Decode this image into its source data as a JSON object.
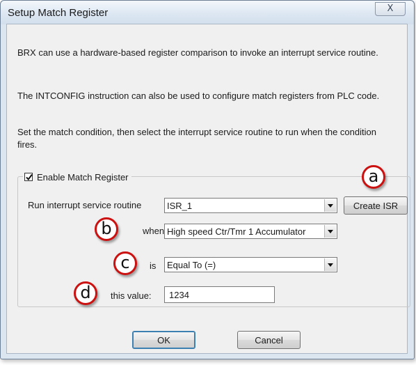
{
  "window": {
    "title": "Setup Match Register",
    "close_glyph": "X"
  },
  "description": {
    "p1": "BRX can use a hardware-based register comparison to invoke an interrupt service routine.",
    "p2": "The INTCONFIG instruction can also be used to configure match registers from PLC code.",
    "p3": "Set the match condition, then select the interrupt service routine to run when the condition fires."
  },
  "group": {
    "enable_label": "Enable Match Register",
    "enable_checked": true,
    "isr_label": "Run interrupt service routine",
    "isr_value": "ISR_1",
    "create_isr_label": "Create ISR",
    "when_label": "when",
    "when_value": "High speed Ctr/Tmr 1 Accumulator",
    "is_label": "is",
    "is_value": "Equal To (=)",
    "value_label": "this value:",
    "value_value": "1234"
  },
  "callouts": {
    "a": "a",
    "b": "b",
    "c": "c",
    "d": "d"
  },
  "buttons": {
    "ok": "OK",
    "cancel": "Cancel"
  },
  "colors": {
    "callout_border": "#cc1111",
    "dialog_frame": "#dce6f0",
    "client_area": "#f0f0f0"
  }
}
